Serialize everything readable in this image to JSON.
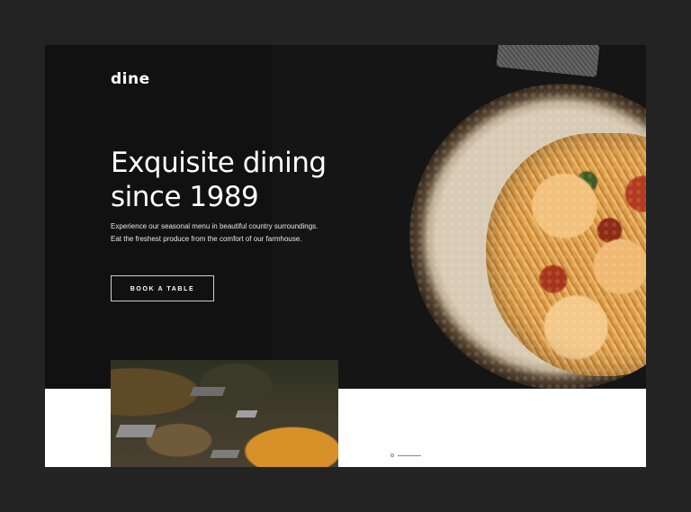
{
  "brand": {
    "logo": "dine"
  },
  "hero": {
    "headline_line1": "Exquisite dining",
    "headline_line2": "since 1989",
    "intro": "Experience our seasonal menu in beautiful country surroundings. Eat the freshest produce from the comfort of our farmhouse.",
    "cta_label": "BOOK A TABLE"
  },
  "images": {
    "dish": "pasta-with-shrimp-image",
    "farmhouse": "farmhouse-village-image"
  },
  "colors": {
    "page_background": "#232323",
    "hero_background": "#151515",
    "text": "#ffffff",
    "section_background": "#ffffff"
  }
}
